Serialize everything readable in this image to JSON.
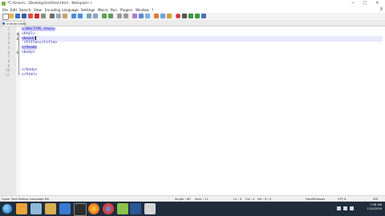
{
  "window": {
    "title": "*C:\\Users\\...\\Desktop\\Untitled.html - Notepad++",
    "minimize": "─",
    "maximize": "□",
    "close": "✕"
  },
  "menu": {
    "items": [
      "File",
      "Edit",
      "Search",
      "View",
      "Encoding",
      "Language",
      "Settings",
      "Macro",
      "Run",
      "Plugins",
      "Window",
      "?"
    ],
    "close_doc": "X"
  },
  "toolbar": {
    "icons": [
      "new-file-icon",
      "open-file-icon",
      "save-icon",
      "save-all-icon",
      "close-icon",
      "close-all-icon",
      "print-icon",
      "cut-icon",
      "copy-icon",
      "paste-icon",
      "undo-icon",
      "redo-icon",
      "find-icon",
      "replace-icon",
      "zoom-in-icon",
      "zoom-out-icon",
      "sync-v-icon",
      "sync-h-icon",
      "wrap-icon",
      "all-chars-icon",
      "indent-guide-icon",
      "lang-icon",
      "doc-map-icon",
      "function-list-icon",
      "record-macro-icon",
      "stop-macro-icon",
      "play-macro-icon",
      "run-macro-icon",
      "save-macro-icon"
    ]
  },
  "tab": {
    "label": "untitled.html",
    "close": "x"
  },
  "editor": {
    "lines": [
      {
        "num": "1",
        "text": "<!DOCTYPE html>"
      },
      {
        "num": "2",
        "text": "<html>"
      },
      {
        "num": "3",
        "text": "<head>"
      },
      {
        "num": "4",
        "text": "<title></title>"
      },
      {
        "num": "5",
        "text": "</head>"
      },
      {
        "num": "6",
        "text": "<body>"
      },
      {
        "num": "7",
        "text": ""
      },
      {
        "num": "8",
        "text": ""
      },
      {
        "num": "9",
        "text": ""
      },
      {
        "num": "10",
        "text": "</body>"
      },
      {
        "num": "11",
        "text": "</html>"
      }
    ]
  },
  "status": {
    "file_type": "Hyper Text Markup Language file",
    "length": "length : 80",
    "lines": "lines : 11",
    "ln": "Ln : 3",
    "col": "Col : 4",
    "sel": "Sel : 0 | 0",
    "eol": "Dos\\Windows",
    "encoding": "UTF-8",
    "mode": "INS"
  },
  "taskbar": {
    "time": "7:26 AM",
    "date": "12/4/2016"
  },
  "colors": {
    "keyword": "#1a1aa6",
    "tag_highlight": "#c8c8ff",
    "current_line": "#e8e8ff",
    "taskbar": "#1f2d3d"
  }
}
